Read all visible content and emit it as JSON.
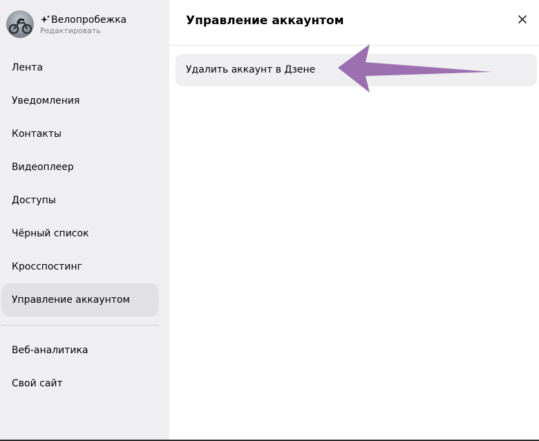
{
  "profile": {
    "name": "Велопробежка",
    "edit_label": "Редактировать"
  },
  "sidebar": {
    "items": [
      {
        "label": "Лента"
      },
      {
        "label": "Уведомления"
      },
      {
        "label": "Контакты"
      },
      {
        "label": "Видеоплеер"
      },
      {
        "label": "Доступы"
      },
      {
        "label": "Чёрный список"
      },
      {
        "label": "Кросспостинг"
      },
      {
        "label": "Управление аккаунтом",
        "active": true
      }
    ],
    "extra_items": [
      {
        "label": "Веб-аналитика"
      },
      {
        "label": "Свой сайт"
      }
    ]
  },
  "main": {
    "title": "Управление аккаунтом",
    "close_icon": "close-icon",
    "actions": [
      {
        "label": "Удалить аккаунт в Дзене"
      }
    ]
  },
  "annotation": {
    "arrow_color": "#9b6fb0"
  },
  "colors": {
    "sidebar_bg": "#efeff1",
    "active_bg": "#e1e1e4"
  }
}
